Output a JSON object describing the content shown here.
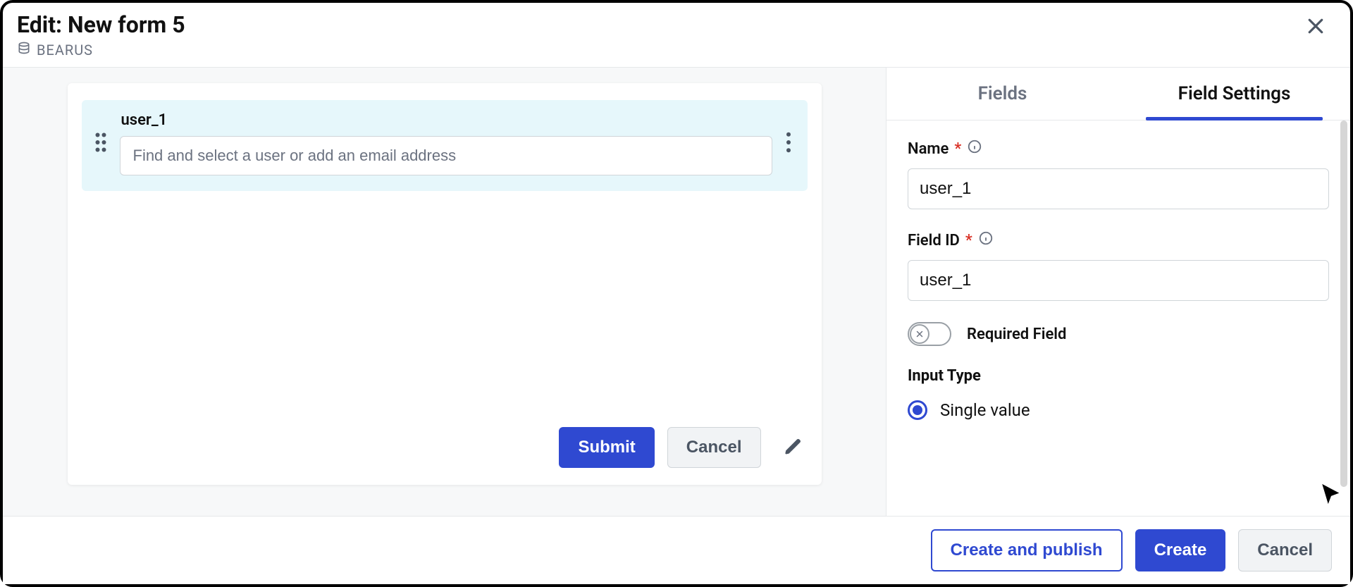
{
  "header": {
    "title": "Edit: New form 5",
    "datasource": "BEARUS"
  },
  "form": {
    "field_label": "user_1",
    "field_placeholder": "Find and select a user or add an email address",
    "submit_label": "Submit",
    "cancel_label": "Cancel"
  },
  "sidebar": {
    "tabs": {
      "fields": "Fields",
      "field_settings": "Field Settings"
    },
    "name_label": "Name",
    "name_value": "user_1",
    "fieldid_label": "Field ID",
    "fieldid_value": "user_1",
    "required_label": "Required Field",
    "required_on": false,
    "input_type_heading": "Input Type",
    "input_type_options": {
      "single": "Single value"
    }
  },
  "footer": {
    "create_publish": "Create and publish",
    "create": "Create",
    "cancel": "Cancel"
  }
}
